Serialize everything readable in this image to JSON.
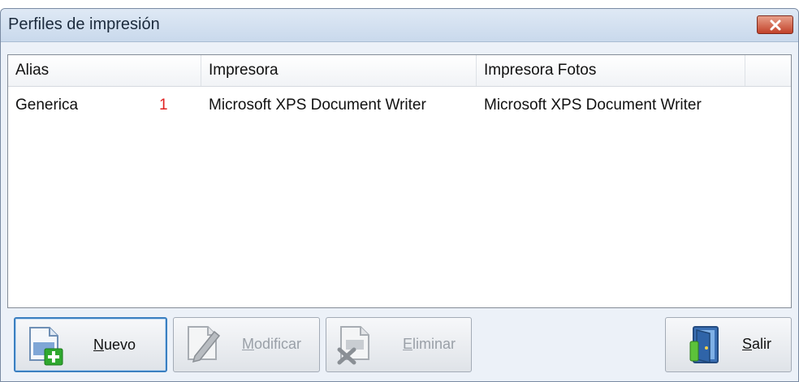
{
  "window": {
    "title": "Perfiles de impresión"
  },
  "list": {
    "columns": [
      "Alias",
      "Impresora",
      "Impresora Fotos"
    ],
    "rows": [
      {
        "alias": "Generica",
        "num": "1",
        "impresora": "Microsoft XPS Document Writer",
        "impresora_fotos": "Microsoft XPS Document Writer"
      }
    ]
  },
  "buttons": {
    "nuevo": {
      "mnemonic": "N",
      "rest": "uevo"
    },
    "modificar": {
      "mnemonic": "M",
      "rest": "odificar"
    },
    "eliminar": {
      "mnemonic": "E",
      "rest": "liminar"
    },
    "salir": {
      "mnemonic": "S",
      "rest": "alir"
    }
  },
  "colors": {
    "close": "#c2422a",
    "row_number": "#e02020",
    "focus": "#3a7fc1"
  }
}
